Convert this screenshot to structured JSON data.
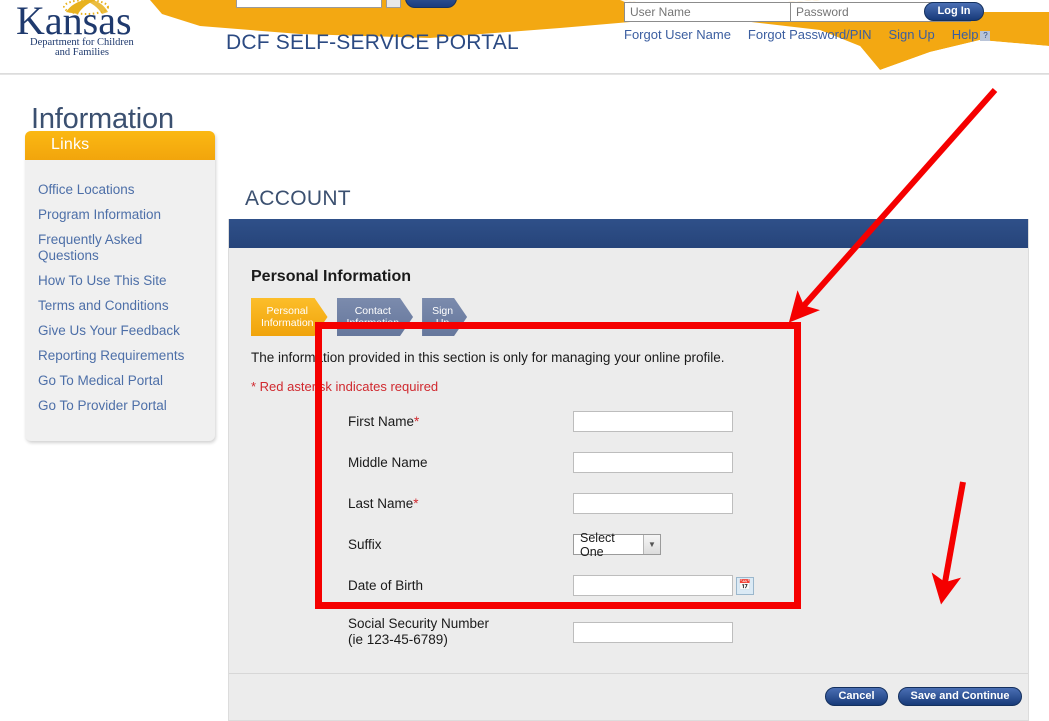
{
  "header": {
    "logo_name": "Kansas",
    "logo_sub_line1": "Department for Children",
    "logo_sub_line2": "and Families",
    "portal_title": "DCF SELF-SERVICE PORTAL",
    "search_placeholder": "",
    "login": {
      "username_placeholder": "User Name",
      "password_placeholder": "Password",
      "login_button": "Log In",
      "links": [
        "Forgot User Name",
        "Forgot Password/PIN",
        "Sign Up",
        "Help"
      ],
      "help_icon": "question-mark-icon"
    }
  },
  "sidebar": {
    "heading": "Information",
    "panel_title": "Links",
    "items": [
      {
        "label": "Office Locations"
      },
      {
        "label": "Program Information"
      },
      {
        "label": "Frequently Asked Questions"
      },
      {
        "label": "How To Use This Site"
      },
      {
        "label": "Terms and Conditions"
      },
      {
        "label": "Give Us Your Feedback"
      },
      {
        "label": "Reporting Requirements"
      },
      {
        "label": "Go To Medical Portal"
      },
      {
        "label": "Go To Provider Portal"
      }
    ]
  },
  "main": {
    "page_title": "ACCOUNT",
    "section_title": "Personal Information",
    "wizard": [
      {
        "line1": "Personal",
        "line2": "Information",
        "state": "active"
      },
      {
        "line1": "Contact",
        "line2": "Information",
        "state": "inactive"
      },
      {
        "line1": "Sign",
        "line2": "Up",
        "state": "inactive"
      }
    ],
    "intro_text": "The information provided in this section is only for managing your online profile.",
    "required_note": "* Red asterisk indicates required",
    "form": {
      "first_name": {
        "label": "First Name",
        "required": "*",
        "value": ""
      },
      "middle_name": {
        "label": "Middle Name",
        "required": "",
        "value": ""
      },
      "last_name": {
        "label": "Last Name",
        "required": "*",
        "value": ""
      },
      "suffix": {
        "label": "Suffix",
        "selected": "Select One",
        "arrow": "▼"
      },
      "dob": {
        "label": "Date of Birth",
        "value": "",
        "calendar_icon": "calendar-icon"
      },
      "ssn": {
        "label_line1": "Social Security Number",
        "label_line2": "(ie 123-45-6789)",
        "value": ""
      }
    },
    "footer": {
      "cancel_label": "Cancel",
      "save_label": "Save and Continue"
    }
  },
  "annotations": {
    "highlight_color": "#f50000",
    "arrow_color": "#f50000",
    "shapes": [
      "red-rectangle-around-form",
      "red-arrow-to-form",
      "red-arrow-to-save-button"
    ]
  },
  "colors": {
    "brand_navy": "#2b4a82",
    "brand_gold": "#f2a50c",
    "bar_blue": "#2b4a82",
    "link_blue": "#4d6fa8",
    "required_red": "#d0292f"
  }
}
